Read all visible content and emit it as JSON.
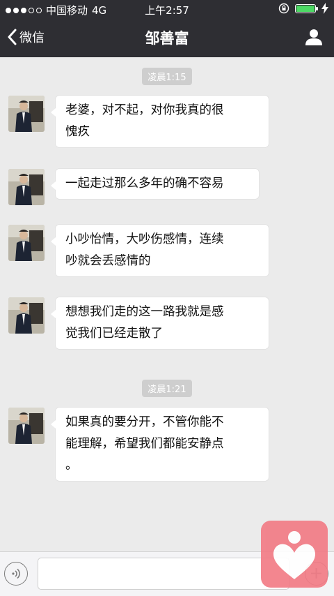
{
  "status_bar": {
    "carrier": "中国移动",
    "network": "4G",
    "time": "上午2:57",
    "battery_percent": 100,
    "signal_dots_filled": 3,
    "signal_dots_total": 5
  },
  "nav": {
    "back_label": "微信",
    "title": "邹善富",
    "profile_icon": "person-icon"
  },
  "chat": {
    "groups": [
      {
        "timestamp": "凌晨1:15",
        "messages": [
          {
            "lines": [
              "老婆，对不起，对你我真的很",
              "愧疚"
            ]
          },
          {
            "lines": [
              "一起走过那么多年的确不容易"
            ]
          },
          {
            "lines": [
              "小吵怡情，大吵伤感情，连续",
              "吵就会丢感情的"
            ]
          },
          {
            "lines": [
              "想想我们走的这一路我就是感",
              "觉我们已经走散了"
            ]
          }
        ]
      },
      {
        "timestamp": "凌晨1:21",
        "messages": [
          {
            "lines": [
              "如果真的要分开，不管你能不",
              "能理解，希望我们都能安静点",
              "。"
            ]
          }
        ]
      }
    ]
  },
  "input": {
    "voice_icon": "voice-icon",
    "value": "",
    "plus_icon": "plus-icon"
  },
  "colors": {
    "nav_bg": "#2e2e33",
    "chat_bg": "#ebebeb",
    "bubble_bg": "#ffffff",
    "timestamp_bg": "#cecece",
    "watermark_bg": "#f27c86"
  }
}
